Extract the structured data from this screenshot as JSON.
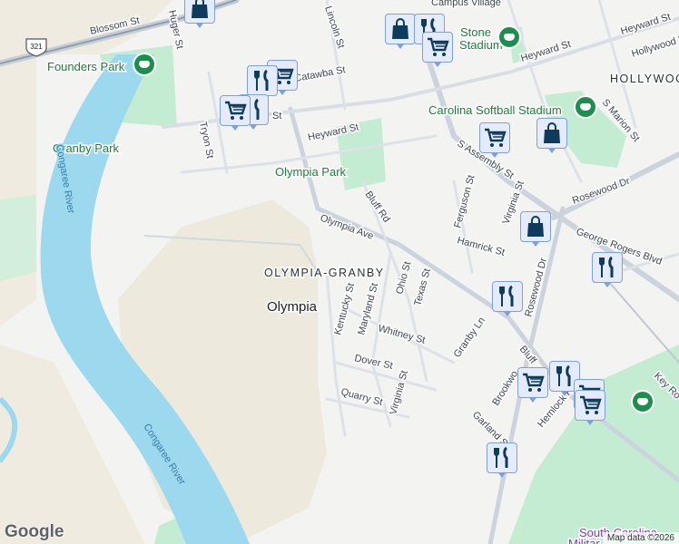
{
  "map": {
    "labels": {
      "blossom_st": "Blossom St",
      "huger_st": "Huger St",
      "founders_park": "Founders Park",
      "granby_park": "Granby Park",
      "tryon_st": "Tryon St",
      "congaree_river_1": "Congaree River",
      "congaree_river_2": "Congaree River",
      "heyward_st_1": "Heyward St",
      "heyward_st_2": "Heyward St",
      "heyward_st_3": "Heyward St",
      "catawba_st": "Catawba St",
      "st_partial": "St",
      "lincoln_st": "Lincoln St",
      "stone_stadium_1": "Stone",
      "stone_stadium_2": "Stadium",
      "hollywood_dr": "Hollywood Dr",
      "hollywood": "HOLLYWOOD",
      "carolina_softball": "Carolina Softball Stadium",
      "s_marion_st": "S Marion St",
      "s_assembly_st": "S Assembly St",
      "olympia_park": "Olympia Park",
      "rosewood_dr_1": "Rosewood Dr",
      "rosewood_dr_2": "Rosewood Dr",
      "bluff_rd": "Bluff Rd",
      "ferguson_st": "Ferguson St",
      "virginia_st_1": "Virginia St",
      "virginia_st_2": "Virginia St",
      "olympia_ave": "Olympia Ave",
      "hamrick_st": "Hamrick St",
      "george_rogers_blvd": "George Rogers Blvd",
      "olympia_granby": "OLYMPIA-GRANBY",
      "olympia": "Olympia",
      "kentucky_st": "Kentucky St",
      "maryland_st": "Maryland St",
      "ohio_st": "Ohio St",
      "texas_st": "Texas St",
      "whitney_st": "Whitney St",
      "granby_ln": "Granby Ln",
      "bluff": "Bluff",
      "dover_st": "Dover St",
      "quarry_st": "Quarry St",
      "brookwood": "Brookwo",
      "garland_st": "Garland St",
      "hemlock": "Hemlock R",
      "key_rd": "Key Ro",
      "sc_military_1": "South Carolina",
      "sc_military_2": "Militar",
      "route_shield": "321",
      "campus_village": "Campus Village"
    },
    "attribution": "Map data ©2026",
    "logo": "Google",
    "colors": {
      "water": "#9cd9ef",
      "park": "#c4ecd2",
      "sand": "#efebe0",
      "pin_icon": "#0e3a5c",
      "pin_bg": "#e4ecfb"
    }
  }
}
